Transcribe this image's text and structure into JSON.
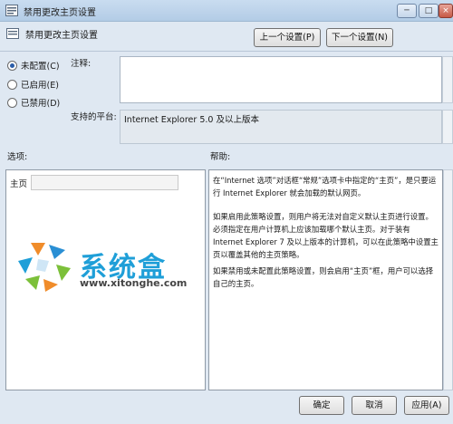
{
  "window": {
    "title": "禁用更改主页设置",
    "min_glyph": "─",
    "max_glyph": "□",
    "close_glyph": "×"
  },
  "header": {
    "title": "禁用更改主页设置",
    "prev_button": "上一个设置(P)",
    "next_button": "下一个设置(N)"
  },
  "state": {
    "not_configured": "未配置(C)",
    "enabled": "已启用(E)",
    "disabled": "已禁用(D)",
    "selected": "not_configured"
  },
  "comment": {
    "label": "注释:",
    "value": ""
  },
  "platform": {
    "label": "支持的平台:",
    "value": "Internet Explorer 5.0 及以上版本"
  },
  "options": {
    "label": "选项:",
    "home_label": "主页",
    "home_value": ""
  },
  "help": {
    "label": "帮助:",
    "paragraphs": [
      "在“Internet 选项”对话框“常规”选项卡中指定的“主页”，是只要运行 Internet Explorer 就会加载的默认网页。",
      "如果启用此策略设置，则用户将无法对自定义默认主页进行设置。必须指定在用户计算机上应该加载哪个默认主页。对于装有 Internet Explorer 7 及以上版本的计算机，可以在此策略中设置主页以覆盖其他的主页策略。",
      "如果禁用或未配置此策略设置，则会启用“主页”框，用户可以选择自己的主页。"
    ]
  },
  "watermark": {
    "name": "系统盒",
    "url": "www.xitonghe.com"
  },
  "footer": {
    "ok": "确定",
    "cancel": "取消",
    "apply": "应用(A)"
  }
}
